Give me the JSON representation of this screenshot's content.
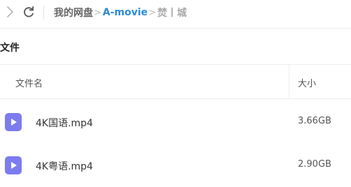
{
  "toolbar": {
    "back_icon": "chevron-left-icon",
    "refresh_icon": "refresh-icon"
  },
  "breadcrumb": {
    "root": "我的网盘",
    "separator": ">",
    "folder": "A-movie",
    "current": "焚丨城"
  },
  "section": {
    "title": "文件"
  },
  "table": {
    "columns": {
      "name": "文件名",
      "size": "大小"
    },
    "rows": [
      {
        "name": "4K国语.mp4",
        "size": "3.66GB",
        "icon": "video-file-icon"
      },
      {
        "name": "4K粤语.mp4",
        "size": "2.90GB",
        "icon": "video-file-icon"
      }
    ]
  },
  "colors": {
    "accent": "#2b8bd8",
    "video_icon": "#7c7cf0"
  }
}
